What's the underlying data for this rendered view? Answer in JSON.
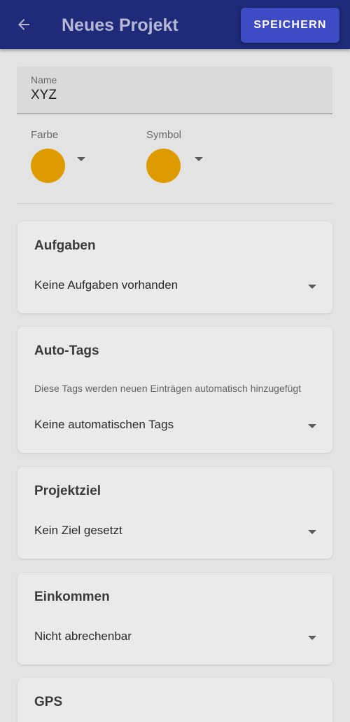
{
  "appbar": {
    "title": "Neues Projekt",
    "back_icon": "arrow-left-icon",
    "save_label": "SPEICHERN"
  },
  "name_field": {
    "label": "Name",
    "value": "XYZ"
  },
  "pickers": {
    "color": {
      "label": "Farbe",
      "value_color": "#e8a200"
    },
    "symbol": {
      "label": "Symbol",
      "value_color": "#e8a200"
    }
  },
  "cards": {
    "tasks": {
      "title": "Aufgaben",
      "value": "Keine Aufgaben vorhanden"
    },
    "autotags": {
      "title": "Auto-Tags",
      "description": "Diese Tags werden neuen Einträgen automatisch hinzugefügt",
      "value": "Keine automatischen Tags"
    },
    "goal": {
      "title": "Projektziel",
      "value": "Kein Ziel gesetzt"
    },
    "income": {
      "title": "Einkommen",
      "value": "Nicht abrechenbar"
    },
    "gps": {
      "title": "GPS"
    }
  },
  "colors": {
    "appbar": "#1f2a78",
    "save_button": "#3d4cc4",
    "accent": "#e8a200"
  }
}
